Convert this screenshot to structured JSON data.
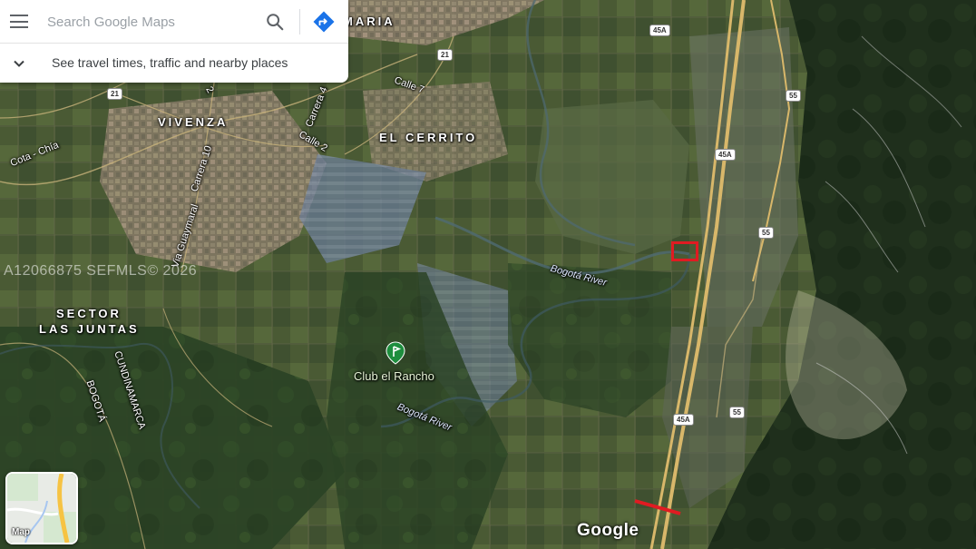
{
  "search": {
    "placeholder": "Search Google Maps",
    "travel_text": "See travel times, traffic and nearby places"
  },
  "map": {
    "places": [
      {
        "name": "MARIA"
      },
      {
        "name": "VIVENZA"
      },
      {
        "name": "EL CERRITO"
      },
      {
        "name": "SECTOR"
      },
      {
        "name": "LAS JUNTAS"
      }
    ],
    "roads": [
      {
        "name": "Calle 7"
      },
      {
        "name": "Carrera 4"
      },
      {
        "name": "Calle 2"
      },
      {
        "name": "Carrera 10"
      },
      {
        "name": "Cota - Chía"
      },
      {
        "name": "Via Guaymaral"
      },
      {
        "name": "CUNDINAMARCA"
      },
      {
        "name": "BOGOTÁ"
      },
      {
        "name": "2"
      }
    ],
    "rivers": [
      {
        "name": "Bogotá River"
      },
      {
        "name": "Bogotá River"
      }
    ],
    "shields": [
      "45A",
      "21",
      "21",
      "55",
      "45A",
      "55",
      "45A",
      "55"
    ],
    "poi": {
      "name": "Club el Rancho",
      "icon": "golf-course-pin-icon",
      "color": "#1e8e3e"
    },
    "marker_color": "#e01b22"
  },
  "watermark": "A12066875  SEFMLS© 2026",
  "minimap_label": "Map",
  "logo": "Google"
}
